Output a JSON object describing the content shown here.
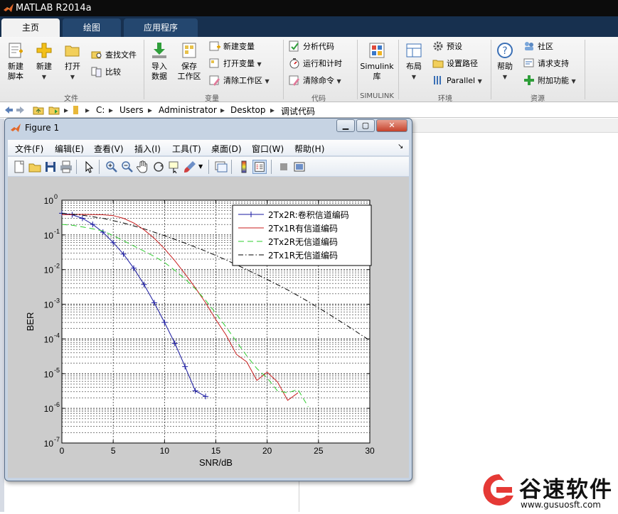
{
  "app": {
    "title": "MATLAB R2014a"
  },
  "tabs": [
    {
      "label": "主页"
    },
    {
      "label": "绘图"
    },
    {
      "label": "应用程序"
    }
  ],
  "ribbon": {
    "file": {
      "group": "文件",
      "new_script": "新建\n脚本",
      "new_script_l1": "新建",
      "new_script_l2": "脚本",
      "new": "新建",
      "open": "打开",
      "find_files": "查找文件",
      "compare": "比较"
    },
    "variable": {
      "group": "变量",
      "import_l1": "导入",
      "import_l2": "数据",
      "save_l1": "保存",
      "save_l2": "工作区",
      "new_var": "新建变量",
      "open_var": "打开变量",
      "clear_ws": "清除工作区"
    },
    "code": {
      "group": "代码",
      "analyze": "分析代码",
      "run_time": "运行和计时",
      "clear_cmd": "清除命令"
    },
    "simulink": {
      "group": "SIMULINK",
      "label_l1": "Simulink",
      "label_l2": "库"
    },
    "environment": {
      "group": "环境",
      "layout": "布局",
      "preferences": "预设",
      "set_path": "设置路径",
      "parallel": "Parallel"
    },
    "resources": {
      "group": "资源",
      "help": "帮助",
      "community": "社区",
      "support": "请求支持",
      "addons": "附加功能"
    }
  },
  "address": {
    "crumbs": [
      "C:",
      "Users",
      "Administrator",
      "Desktop",
      "调试代码"
    ]
  },
  "figure": {
    "title": "Figure 1",
    "menu": [
      "文件(F)",
      "编辑(E)",
      "查看(V)",
      "插入(I)",
      "工具(T)",
      "桌面(D)",
      "窗口(W)",
      "帮助(H)"
    ]
  },
  "colors": {
    "series1": "#1a1aa0",
    "series2": "#c81e1e",
    "series3": "#2ecc2e",
    "series4": "#000000",
    "titlebar": "#0c0c0c",
    "tabstrip": "#17304f"
  },
  "chart_data": {
    "type": "line",
    "title": "",
    "xlabel": "SNR/dB",
    "ylabel": "BER",
    "xlim": [
      0,
      30
    ],
    "ylim": [
      1e-07,
      1
    ],
    "yscale": "log",
    "grid": true,
    "legend_position": "top-right",
    "x_ticks": [
      "0",
      "5",
      "10",
      "15",
      "20",
      "25",
      "30"
    ],
    "y_ticks": [
      {
        "base": "10",
        "exp": "0"
      },
      {
        "base": "10",
        "exp": "-1"
      },
      {
        "base": "10",
        "exp": "-2"
      },
      {
        "base": "10",
        "exp": "-3"
      },
      {
        "base": "10",
        "exp": "-4"
      },
      {
        "base": "10",
        "exp": "-5"
      },
      {
        "base": "10",
        "exp": "-6"
      },
      {
        "base": "10",
        "exp": "-7"
      }
    ],
    "series": [
      {
        "name": "2Tx2R:卷积信道编码",
        "style": "solid-plus",
        "x": [
          0,
          1,
          2,
          3,
          4,
          5,
          6,
          7,
          8,
          9,
          10,
          11,
          12,
          13,
          14
        ],
        "y": [
          0.42,
          0.38,
          0.3,
          0.2,
          0.12,
          0.06,
          0.028,
          0.011,
          0.0037,
          0.0011,
          0.0003,
          7.5e-05,
          1.6e-05,
          3.2e-06,
          2.2e-06
        ]
      },
      {
        "name": "2Tx1R有信道编码",
        "style": "solid",
        "x": [
          0,
          2,
          4,
          5,
          6,
          7,
          8,
          9,
          10,
          11,
          12,
          13,
          14,
          15,
          16,
          17,
          18,
          19,
          20,
          21,
          22,
          23
        ],
        "y": [
          0.38,
          0.39,
          0.38,
          0.36,
          0.3,
          0.22,
          0.14,
          0.08,
          0.04,
          0.018,
          0.0075,
          0.003,
          0.0011,
          0.00036,
          0.00013,
          3.6e-05,
          2.2e-05,
          6.4e-06,
          1.1e-05,
          5.8e-06,
          1.7e-06,
          2.8e-06
        ]
      },
      {
        "name": "2Tx2R无信道编码",
        "style": "dashed",
        "x": [
          0,
          1,
          2,
          3,
          4,
          5,
          6,
          7,
          8,
          9,
          10,
          11,
          12,
          13,
          14,
          15,
          16,
          17,
          18,
          19,
          20,
          21,
          22,
          23,
          24
        ],
        "y": [
          0.2,
          0.19,
          0.17,
          0.15,
          0.13,
          0.095,
          0.068,
          0.048,
          0.034,
          0.024,
          0.016,
          0.0095,
          0.0054,
          0.0028,
          0.0013,
          0.00055,
          0.00022,
          8.5e-05,
          3.3e-05,
          1.4e-05,
          7.5e-06,
          3.2e-06,
          2.8e-06,
          3.5e-06,
          1.1e-06
        ]
      },
      {
        "name": "2Tx1R无信道编码",
        "style": "dashdot",
        "x": [
          0,
          2,
          4,
          6,
          8,
          10,
          12,
          14,
          16,
          18,
          20,
          22,
          24,
          26,
          28,
          30
        ],
        "y": [
          0.42,
          0.37,
          0.3,
          0.22,
          0.15,
          0.095,
          0.058,
          0.034,
          0.019,
          0.01,
          0.0052,
          0.0026,
          0.0012,
          0.00052,
          0.00022,
          9e-05
        ]
      }
    ]
  },
  "watermark": {
    "brand": "谷速软件",
    "url": "www.gusuosft.com"
  }
}
